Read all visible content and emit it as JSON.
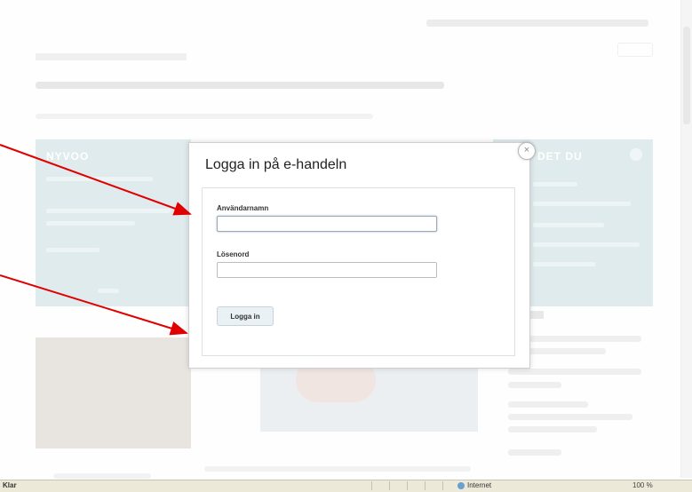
{
  "background": {
    "left_panel_title": "NYVOO",
    "right_panel_title": "DET DU"
  },
  "modal": {
    "title": "Logga in på e-handeln",
    "close_glyph": "×",
    "username_label": "Användarnamn",
    "username_value": "",
    "password_label": "Lösenord",
    "password_value": "",
    "login_button": "Logga in"
  },
  "status_bar": {
    "left_text": "Klar",
    "zone_text": "Internet",
    "zoom_text": "100 %"
  },
  "colors": {
    "annotation_arrow": "#e00000",
    "panel": "#cfe0e3",
    "button_bg": "#eaf1f5"
  }
}
